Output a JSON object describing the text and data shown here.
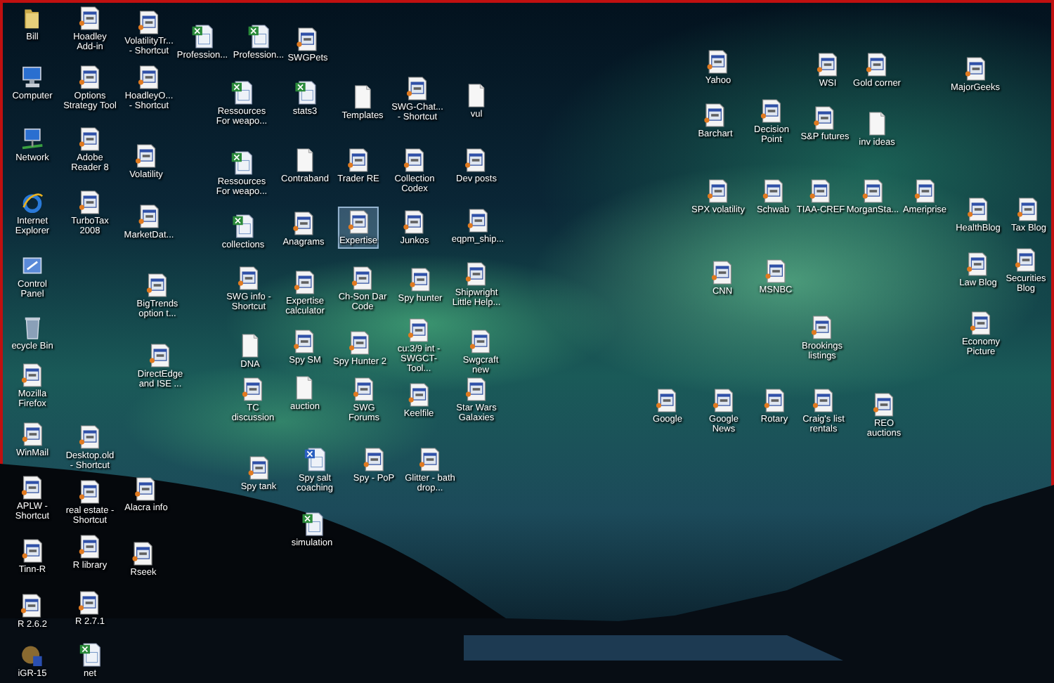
{
  "desktop": {
    "icons": [
      {
        "label": "Bill",
        "kind": "folder",
        "selected": false
      },
      {
        "label": "Hoadley Add-in",
        "kind": "doc",
        "selected": false
      },
      {
        "label": "VolatilityTr... - Shortcut",
        "kind": "doc",
        "selected": false
      },
      {
        "label": "Computer",
        "kind": "computer",
        "selected": false
      },
      {
        "label": "Options Strategy Tool",
        "kind": "doc",
        "selected": false
      },
      {
        "label": "HoadleyO... - Shortcut",
        "kind": "doc",
        "selected": false
      },
      {
        "label": "Network",
        "kind": "network",
        "selected": false
      },
      {
        "label": "Adobe Reader 8",
        "kind": "doc",
        "selected": false
      },
      {
        "label": "Volatility",
        "kind": "doc",
        "selected": false
      },
      {
        "label": "Internet Explorer",
        "kind": "ie",
        "selected": false
      },
      {
        "label": "TurboTax 2008",
        "kind": "doc",
        "selected": false
      },
      {
        "label": "MarketDat...",
        "kind": "doc",
        "selected": false
      },
      {
        "label": "Control Panel",
        "kind": "control",
        "selected": false
      },
      {
        "label": "BigTrends option t...",
        "kind": "doc",
        "selected": false
      },
      {
        "label": "ecycle Bin",
        "kind": "recycle",
        "selected": false
      },
      {
        "label": "DirectEdge and ISE ...",
        "kind": "doc",
        "selected": false
      },
      {
        "label": "Mozilla Firefox",
        "kind": "doc",
        "selected": false
      },
      {
        "label": "WinMail",
        "kind": "doc",
        "selected": false
      },
      {
        "label": "Desktop.old - Shortcut",
        "kind": "doc",
        "selected": false
      },
      {
        "label": "APLW - Shortcut",
        "kind": "doc",
        "selected": false
      },
      {
        "label": "real estate - Shortcut",
        "kind": "doc",
        "selected": false
      },
      {
        "label": "Alacra info",
        "kind": "doc",
        "selected": false
      },
      {
        "label": "Tinn-R",
        "kind": "doc",
        "selected": false
      },
      {
        "label": "R library",
        "kind": "doc",
        "selected": false
      },
      {
        "label": "Rseek",
        "kind": "doc",
        "selected": false
      },
      {
        "label": "R 2.6.2",
        "kind": "doc",
        "selected": false
      },
      {
        "label": "R 2.7.1",
        "kind": "doc",
        "selected": false
      },
      {
        "label": "iGR-15",
        "kind": "app",
        "selected": false
      },
      {
        "label": "net",
        "kind": "excel",
        "selected": false
      },
      {
        "label": "Profession...",
        "kind": "excel",
        "selected": false
      },
      {
        "label": "Profession...",
        "kind": "excel",
        "selected": false
      },
      {
        "label": "SWGPets",
        "kind": "doc",
        "selected": false
      },
      {
        "label": "Ressources For weapo...",
        "kind": "excel",
        "selected": false
      },
      {
        "label": "stats3",
        "kind": "excel",
        "selected": false
      },
      {
        "label": "Templates",
        "kind": "blank",
        "selected": false
      },
      {
        "label": "SWG-Chat... - Shortcut",
        "kind": "doc",
        "selected": false
      },
      {
        "label": "vul",
        "kind": "blank",
        "selected": false
      },
      {
        "label": "Ressources For weapo...",
        "kind": "excel",
        "selected": false
      },
      {
        "label": "Contraband",
        "kind": "blank",
        "selected": false
      },
      {
        "label": "Trader RE",
        "kind": "doc",
        "selected": false
      },
      {
        "label": "Collection Codex",
        "kind": "doc",
        "selected": false
      },
      {
        "label": "Dev posts",
        "kind": "doc",
        "selected": false
      },
      {
        "label": "collections",
        "kind": "excel",
        "selected": false
      },
      {
        "label": "Anagrams",
        "kind": "doc",
        "selected": false
      },
      {
        "label": "Expertise",
        "kind": "doc",
        "selected": true
      },
      {
        "label": "Junkos",
        "kind": "doc",
        "selected": false
      },
      {
        "label": "eqpm_ship...",
        "kind": "doc",
        "selected": false
      },
      {
        "label": "SWG info - Shortcut",
        "kind": "doc",
        "selected": false
      },
      {
        "label": "Expertise calculator",
        "kind": "doc",
        "selected": false
      },
      {
        "label": "Ch-Son Dar Code",
        "kind": "doc",
        "selected": false
      },
      {
        "label": "Spy hunter",
        "kind": "doc",
        "selected": false
      },
      {
        "label": "Shipwright Little Help...",
        "kind": "doc",
        "selected": false
      },
      {
        "label": "DNA",
        "kind": "blank",
        "selected": false
      },
      {
        "label": "Spy SM",
        "kind": "doc",
        "selected": false
      },
      {
        "label": "Spy Hunter 2",
        "kind": "doc",
        "selected": false
      },
      {
        "label": "cu:3/9 int - SWGCT-Tool...",
        "kind": "doc",
        "selected": false
      },
      {
        "label": "Swgcraft new",
        "kind": "doc",
        "selected": false
      },
      {
        "label": "TC discussion",
        "kind": "doc",
        "selected": false
      },
      {
        "label": "auction",
        "kind": "blank",
        "selected": false
      },
      {
        "label": "SWG Forums",
        "kind": "doc",
        "selected": false
      },
      {
        "label": "Keelfile",
        "kind": "doc",
        "selected": false
      },
      {
        "label": "Star Wars Galaxies",
        "kind": "doc",
        "selected": false
      },
      {
        "label": "Spy tank",
        "kind": "doc",
        "selected": false
      },
      {
        "label": "Spy salt coaching",
        "kind": "word",
        "selected": false
      },
      {
        "label": "Spy - PoP",
        "kind": "doc",
        "selected": false
      },
      {
        "label": "Glitter - bath drop...",
        "kind": "doc",
        "selected": false
      },
      {
        "label": "simulation",
        "kind": "excel",
        "selected": false
      },
      {
        "label": "Yahoo",
        "kind": "doc",
        "selected": false
      },
      {
        "label": "WSI",
        "kind": "doc",
        "selected": false
      },
      {
        "label": "Gold corner",
        "kind": "doc",
        "selected": false
      },
      {
        "label": "MajorGeeks",
        "kind": "doc",
        "selected": false
      },
      {
        "label": "Barchart",
        "kind": "doc",
        "selected": false
      },
      {
        "label": "Decision Point",
        "kind": "doc",
        "selected": false
      },
      {
        "label": "S&P futures",
        "kind": "doc",
        "selected": false
      },
      {
        "label": "inv ideas",
        "kind": "blank",
        "selected": false
      },
      {
        "label": "SPX volatility",
        "kind": "doc",
        "selected": false
      },
      {
        "label": "Schwab",
        "kind": "doc",
        "selected": false
      },
      {
        "label": "TIAA-CREF",
        "kind": "doc",
        "selected": false
      },
      {
        "label": "MorganSta...",
        "kind": "doc",
        "selected": false
      },
      {
        "label": "Ameriprise",
        "kind": "doc",
        "selected": false
      },
      {
        "label": "HealthBlog",
        "kind": "doc",
        "selected": false
      },
      {
        "label": "Tax Blog",
        "kind": "doc",
        "selected": false
      },
      {
        "label": "CNN",
        "kind": "doc",
        "selected": false
      },
      {
        "label": "MSNBC",
        "kind": "doc",
        "selected": false
      },
      {
        "label": "Law Blog",
        "kind": "doc",
        "selected": false
      },
      {
        "label": "Securities Blog",
        "kind": "doc",
        "selected": false
      },
      {
        "label": "Brookings listings",
        "kind": "doc",
        "selected": false
      },
      {
        "label": "Economy Picture",
        "kind": "doc",
        "selected": false
      },
      {
        "label": "Google",
        "kind": "doc",
        "selected": false
      },
      {
        "label": "Google News",
        "kind": "doc",
        "selected": false
      },
      {
        "label": "Rotary",
        "kind": "doc",
        "selected": false
      },
      {
        "label": "Craig's list rentals",
        "kind": "doc",
        "selected": false
      },
      {
        "label": "REO auctions",
        "kind": "doc",
        "selected": false
      }
    ]
  }
}
